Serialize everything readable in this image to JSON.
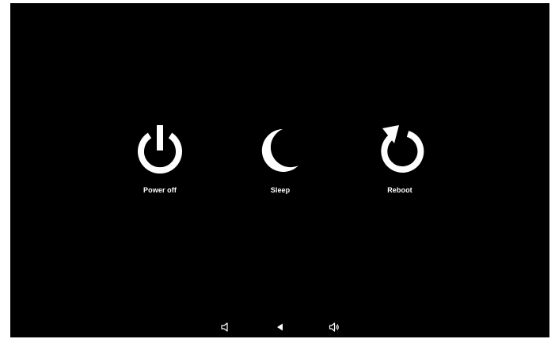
{
  "power_menu": {
    "options": [
      {
        "label": "Power off",
        "icon": "power-icon"
      },
      {
        "label": "Sleep",
        "icon": "moon-icon"
      },
      {
        "label": "Reboot",
        "icon": "reboot-icon"
      }
    ]
  },
  "navbar": {
    "buttons": [
      {
        "icon": "volume-down-icon"
      },
      {
        "icon": "back-icon"
      },
      {
        "icon": "volume-up-icon"
      }
    ]
  },
  "colors": {
    "background": "#000000",
    "foreground": "#ffffff",
    "outer": "#ffffff"
  }
}
